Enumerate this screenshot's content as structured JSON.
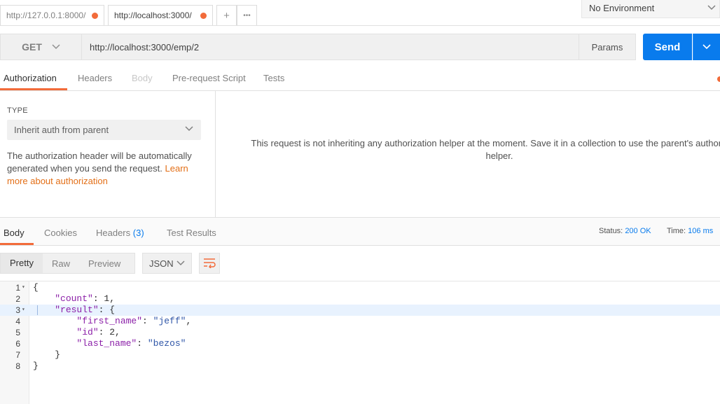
{
  "tabs": [
    {
      "label": "http://127.0.0.1:8000/"
    },
    {
      "label": "http://localhost:3000/"
    }
  ],
  "tab_actions": {
    "add": "+",
    "more": "•••"
  },
  "environment": {
    "selected": "No Environment"
  },
  "request": {
    "method": "GET",
    "url": "http://localhost:3000/emp/2",
    "params_label": "Params",
    "send_label": "Send"
  },
  "request_tabs": [
    "Authorization",
    "Headers",
    "Body",
    "Pre-request Script",
    "Tests"
  ],
  "auth": {
    "type_label": "TYPE",
    "type_value": "Inherit auth from parent",
    "desc": "The authorization header will be automatically generated when you send the request.",
    "link": "Learn more about authorization",
    "message": "This request is not inheriting any authorization helper at the moment. Save it in a collection to use the parent's authorization helper."
  },
  "response_tabs": {
    "body": "Body",
    "cookies": "Cookies",
    "headers": "Headers",
    "headers_count": "(3)",
    "tests": "Test Results"
  },
  "status": {
    "label": "Status:",
    "value": "200 OK",
    "time_label": "Time:",
    "time_value": "106 ms"
  },
  "view_modes": [
    "Pretty",
    "Raw",
    "Preview"
  ],
  "format": "JSON",
  "code_lines": [
    {
      "n": "1",
      "fold": true,
      "text": "{"
    },
    {
      "n": "2",
      "fold": false,
      "text": "    \"count\": 1,"
    },
    {
      "n": "3",
      "fold": true,
      "text": "    \"result\": {"
    },
    {
      "n": "4",
      "fold": false,
      "text": "        \"first_name\": \"jeff\","
    },
    {
      "n": "5",
      "fold": false,
      "text": "        \"id\": 2,"
    },
    {
      "n": "6",
      "fold": false,
      "text": "        \"last_name\": \"bezos\""
    },
    {
      "n": "7",
      "fold": false,
      "text": "    }"
    },
    {
      "n": "8",
      "fold": false,
      "text": "}"
    }
  ],
  "colors": {
    "accent": "#f26b3a",
    "primary": "#097bed"
  }
}
